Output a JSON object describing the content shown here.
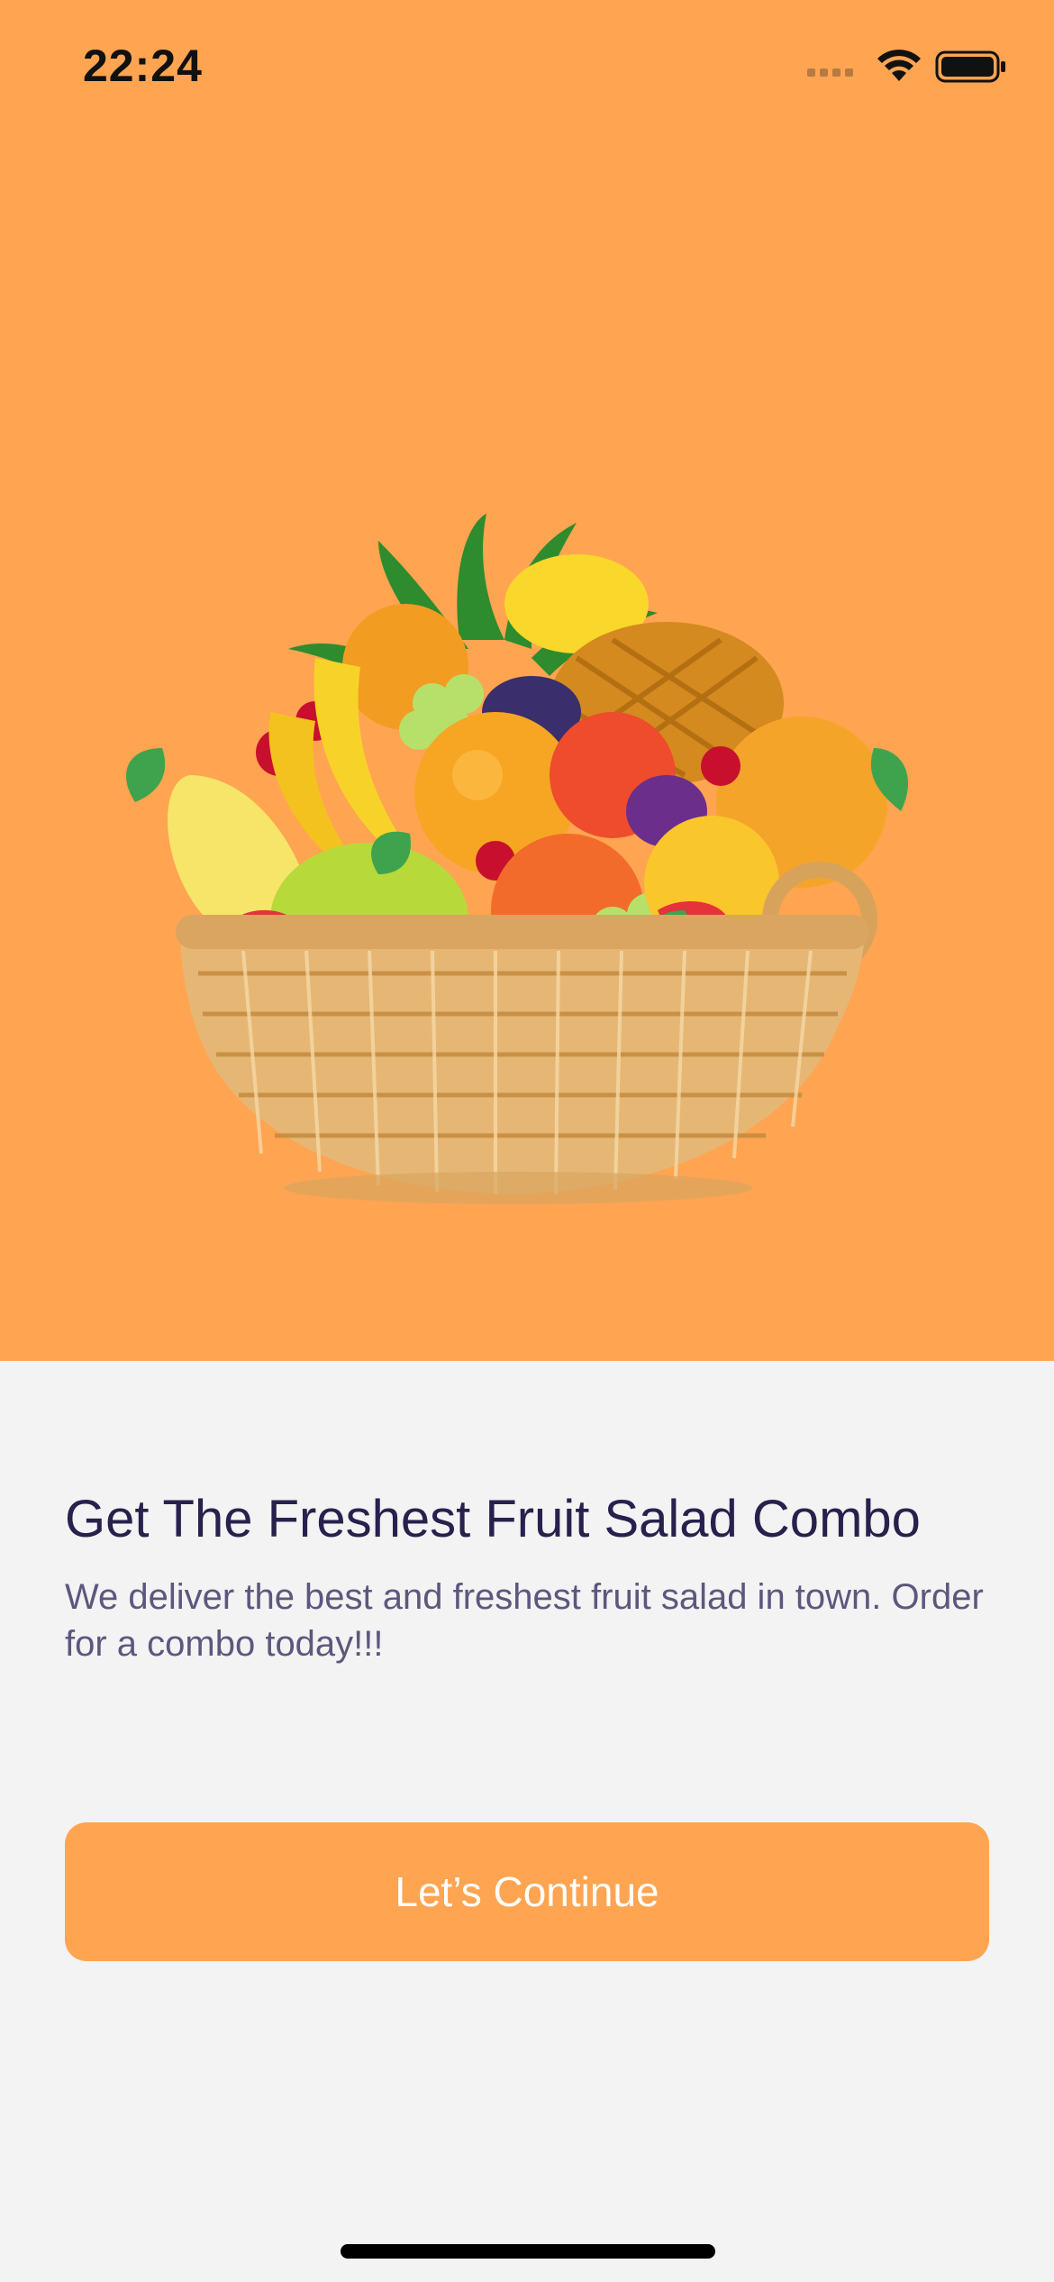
{
  "status_bar": {
    "time": "22:24",
    "icons": [
      "signal-icon",
      "wifi-icon",
      "battery-icon"
    ]
  },
  "hero": {
    "background_color": "#FFA451",
    "illustration": "fruit-basket-illustration"
  },
  "content": {
    "headline": "Get The Freshest Fruit Salad Combo",
    "subtext": "We deliver the best and freshest fruit salad in town. Order for a combo today!!!"
  },
  "cta": {
    "label": "Let’s Continue",
    "color": "#FFA451"
  },
  "colors": {
    "page_background": "#F3F3F3",
    "headline": "#27214D",
    "subtext": "#5D577E"
  }
}
